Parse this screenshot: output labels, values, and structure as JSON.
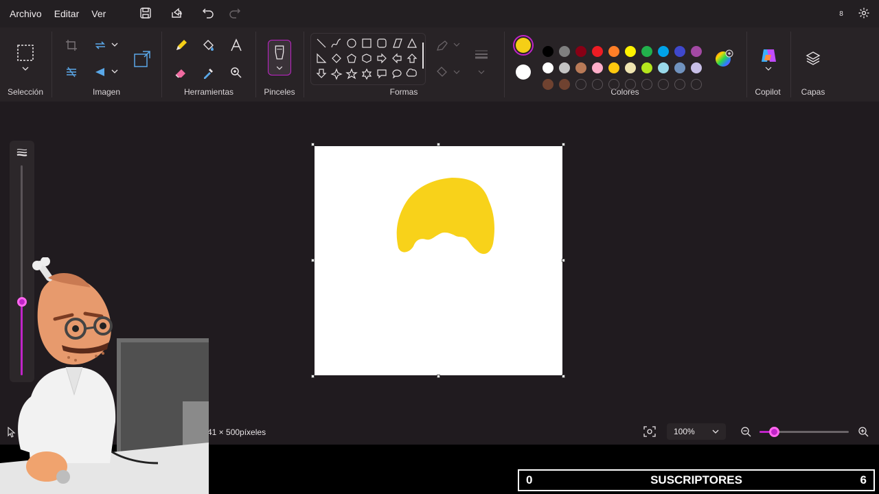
{
  "menu": {
    "file": "Archivo",
    "edit": "Editar",
    "view": "Ver"
  },
  "account_initial": "8",
  "groups": {
    "selection": "Selección",
    "image": "Imagen",
    "tools": "Herramientas",
    "brushes": "Pinceles",
    "shapes": "Formas",
    "colors": "Colores",
    "copilot": "Copilot",
    "layers": "Capas"
  },
  "colors": {
    "primary": "#f5cf16",
    "secondary": "#ffffff",
    "palette_row1": [
      "#000000",
      "#7f7f7f",
      "#880015",
      "#ed1c24",
      "#ff7f27",
      "#fff200",
      "#22b14c",
      "#00a2e8",
      "#3f48cc",
      "#a349a4"
    ],
    "palette_row2": [
      "#ffffff",
      "#c3c3c3",
      "#b97a57",
      "#ffaec9",
      "#ffc90e",
      "#efe4b0",
      "#b5e61d",
      "#99d9ea",
      "#7092be",
      "#c8bfe7"
    ],
    "palette_row3_filled": [
      "#6f4230",
      "#6f4230"
    ]
  },
  "status": {
    "canvas_size": "41 × 500píxeles",
    "zoom": "100%"
  },
  "overlay": {
    "left_count": "0",
    "title": "SUSCRIPTORES",
    "right_count": "6"
  }
}
